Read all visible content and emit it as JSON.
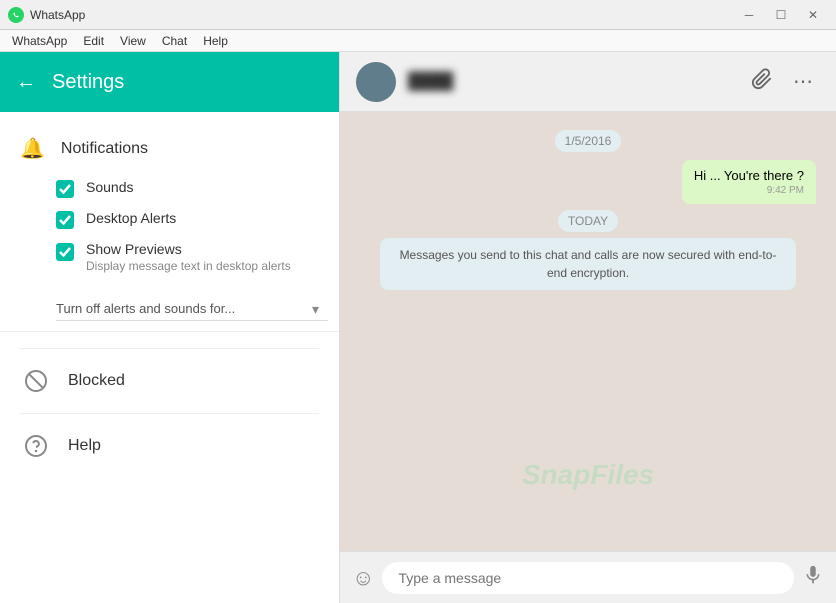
{
  "titlebar": {
    "title": "WhatsApp",
    "min_label": "─",
    "max_label": "☐",
    "close_label": "✕"
  },
  "menubar": {
    "items": [
      "WhatsApp",
      "Edit",
      "View",
      "Chat",
      "Help"
    ]
  },
  "settings": {
    "back_label": "←",
    "title": "Settings",
    "notifications": {
      "section_title": "Notifications",
      "sounds_label": "Sounds",
      "desktop_alerts_label": "Desktop Alerts",
      "show_previews_label": "Show Previews",
      "show_previews_sub": "Display message text in desktop alerts",
      "dropdown_label": "Turn off alerts and sounds for...",
      "dropdown_arrow": "▾"
    },
    "blocked": {
      "label": "Blocked"
    },
    "help": {
      "label": "Help"
    }
  },
  "chat": {
    "user_name": "████",
    "attachment_icon": "📎",
    "more_icon": "⋯",
    "date_badge": "1/5/2016",
    "messages": [
      {
        "type": "sent",
        "text": "Hi ... You're there ?",
        "time": "9:42 PM"
      }
    ],
    "today_badge": "TODAY",
    "info_message": "Messages you send to this chat and calls are now secured with end-to-end encryption.",
    "input_placeholder": "Type a message",
    "emoji_icon": "☺",
    "mic_icon": "🎤"
  },
  "fab": {
    "photo_icon": "photo",
    "camera_icon": "camera",
    "doc_icon": "document"
  },
  "watermark": "SnapFiles"
}
